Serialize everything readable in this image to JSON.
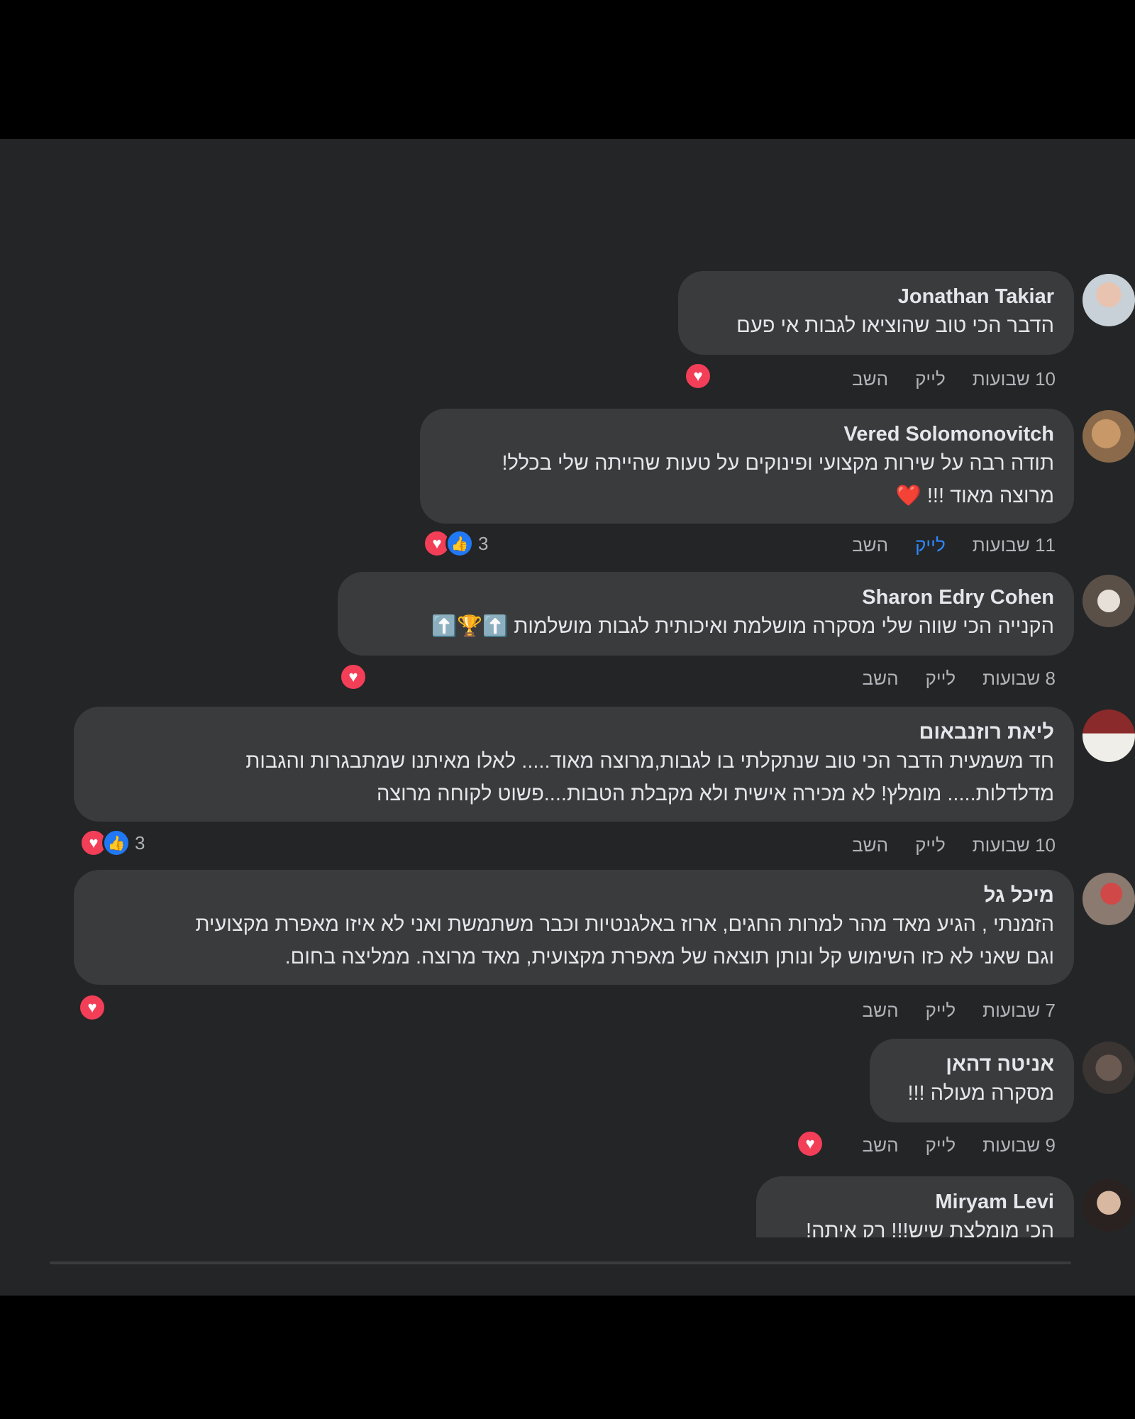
{
  "comments": [
    {
      "author": "Jonathan Takiar",
      "lines": [
        "הדבר הכי טוב שהוציאו לגבות אי פעם"
      ],
      "time": "10 שבועות",
      "like": "לייק",
      "reply": "השב",
      "reactions": {
        "count": ""
      }
    },
    {
      "author": "Vered Solomonovitch",
      "lines": [
        "תודה רבה על שירות מקצועי ופינוקים על טעות שהייתה שלי בכלל!",
        "מרוצה מאוד !!! ❤️"
      ],
      "time": "11 שבועות",
      "like": "לייק",
      "reply": "השב",
      "reactions": {
        "count": "3"
      }
    },
    {
      "author": "Sharon Edry Cohen",
      "lines": [
        "הקנייה הכי שווה שלי מסקרה מושלמת ואיכותית לגבות מושלמות ⬆️🏆⬆️"
      ],
      "time": "8 שבועות",
      "like": "לייק",
      "reply": "השב",
      "reactions": {
        "count": ""
      }
    },
    {
      "author": "ליאת רוזנבאום",
      "lines": [
        "חד משמעית הדבר הכי טוב שנתקלתי בו לגבות,מרוצה מאוד..... לאלו מאיתנו שמתבגרות והגבות",
        "מדלדלות..... מומלץ! לא מכירה אישית ולא מקבלת הטבות....פשוט לקוחה מרוצה"
      ],
      "time": "10 שבועות",
      "like": "לייק",
      "reply": "השב",
      "reactions": {
        "count": "3"
      }
    },
    {
      "author": "מיכל גל",
      "lines": [
        "הזמנתי , הגיע מאד מהר למרות החגים, ארוז באלגנטיות וכבר משתמשת ואני לא איזו מאפרת מקצועית",
        "וגם שאני לא כזו השימוש קל ונותן תוצאה של מאפרת מקצועית, מאד מרוצה. ממליצה בחום."
      ],
      "time": "7 שבועות",
      "like": "לייק",
      "reply": "השב",
      "reactions": {
        "count": ""
      }
    },
    {
      "author": "אניטה דהאן",
      "lines": [
        "מסקרה מעולה !!!"
      ],
      "time": "9 שבועות",
      "like": "לייק",
      "reply": "השב",
      "reactions": {
        "count": ""
      }
    },
    {
      "author": "Miryam Levi",
      "lines": [
        "הכי מומלצת שיש!!! רק איתה!"
      ]
    }
  ],
  "icons": {
    "heart": "heart-icon",
    "like": "thumbs-up-icon"
  },
  "colors": {
    "panel": "#242526",
    "bubble": "#3a3b3c",
    "heart": "#f33e58",
    "like": "#2078f4",
    "liked_text": "#2d88ff"
  }
}
